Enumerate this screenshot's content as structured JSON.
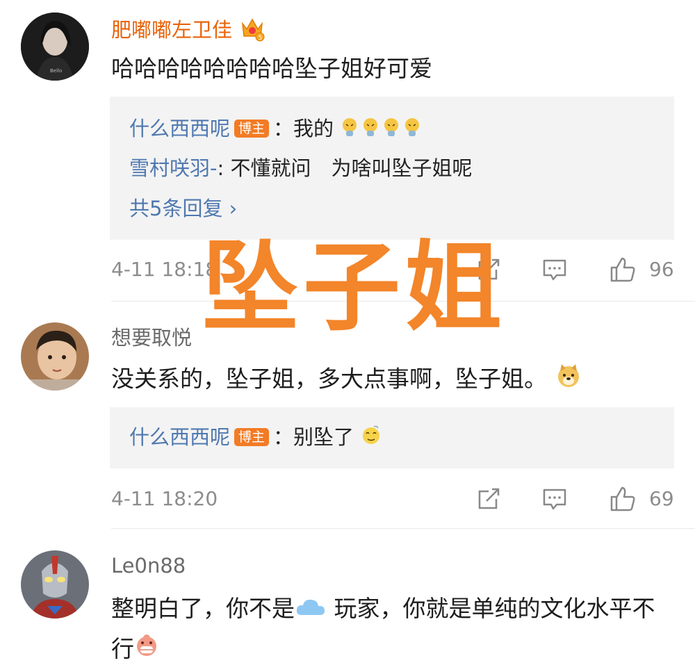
{
  "comments": [
    {
      "username": "肥嘟嘟左卫佳",
      "text": "哈哈哈哈哈哈哈哈坠子姐好可爱",
      "replies": [
        {
          "name": "什么西西呢",
          "badge": "博主",
          "text": "：我的"
        },
        {
          "name": "雪村咲羽-",
          "text": ": 不懂就问　为啥叫坠子姐呢"
        }
      ],
      "more_replies": "共5条回复 ›",
      "time": "4-11 18:18",
      "likes": "96"
    },
    {
      "username": "想要取悦",
      "text": "没关系的，坠子姐，多大点事啊，坠子姐。",
      "replies": [
        {
          "name": "什么西西呢",
          "badge": "博主",
          "text": "：别坠了"
        }
      ],
      "time": "4-11 18:20",
      "likes": "69"
    },
    {
      "username": "Le0n88",
      "text_a": "整明白了，你不是",
      "text_b": " 玩家，你就是单纯的文化水平不行"
    }
  ],
  "overlay_text": "坠子姐",
  "colors": {
    "accent": "#f37b25",
    "link": "#4f78b0",
    "reply_bg": "#f3f3f3",
    "overlay": "#f3852a"
  },
  "icons": [
    "crown-badge-icon",
    "share-icon",
    "comment-icon",
    "like-icon",
    "cloud-emoji",
    "doge-emoji",
    "grin-emoji",
    "dizzy-emoji",
    "cry-emoji"
  ]
}
